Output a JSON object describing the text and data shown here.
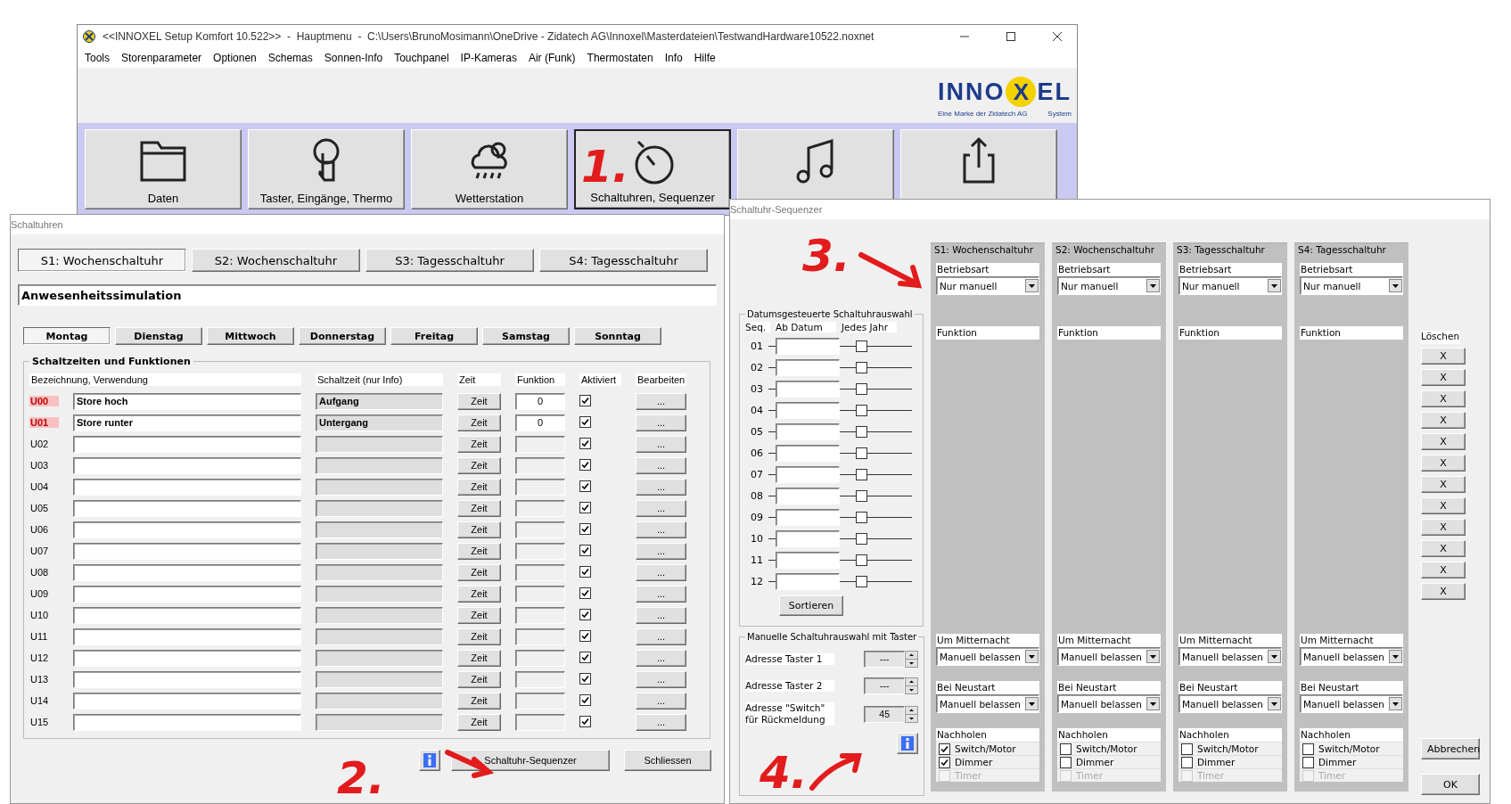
{
  "main_window": {
    "title": "<<INNOXEL Setup Komfort 10.522>>  -  Hauptmenu  -  C:\\Users\\BrunoMosimann\\OneDrive - Zidatech AG\\Innoxel\\Masterdateien\\TestwandHardware10522.noxnet",
    "menu": [
      "Tools",
      "Storenparameter",
      "Optionen",
      "Schemas",
      "Sonnen-Info",
      "Touchpanel",
      "IP-Kameras",
      "Air (Funk)",
      "Thermostaten",
      "Info",
      "Hilfe"
    ],
    "logo": {
      "left": "INNO",
      "mark": "X",
      "right": "EL",
      "tagline": "Eine Marke der Zidatech AG",
      "suffix": "System"
    },
    "toolbar": [
      {
        "label": "Daten",
        "kind": "folder",
        "selected": false
      },
      {
        "label": "Taster, Eingänge, Thermo",
        "kind": "touch",
        "selected": false
      },
      {
        "label": "Wetterstation",
        "kind": "weather",
        "selected": false
      },
      {
        "label": "Schaltuhren, Sequenzer",
        "kind": "timer",
        "selected": true
      },
      {
        "kind": "music",
        "selected": false
      },
      {
        "kind": "share",
        "selected": false
      }
    ]
  },
  "schaltuhren": {
    "title": "Schaltuhren",
    "tabs": [
      {
        "label": "S1: Wochenschaltuhr",
        "selected": true
      },
      {
        "label": "S2: Wochenschaltuhr",
        "selected": false
      },
      {
        "label": "S3: Tagesschaltuhr",
        "selected": false
      },
      {
        "label": "S4: Tagesschaltuhr",
        "selected": false
      }
    ],
    "name": "Anwesenheitssimulation",
    "days": [
      {
        "label": "Montag",
        "selected": true
      },
      {
        "label": "Dienstag",
        "selected": false
      },
      {
        "label": "Mittwoch",
        "selected": false
      },
      {
        "label": "Donnerstag",
        "selected": false
      },
      {
        "label": "Freitag",
        "selected": false
      },
      {
        "label": "Samstag",
        "selected": false
      },
      {
        "label": "Sonntag",
        "selected": false
      }
    ],
    "group_title": "Schaltzeiten und Funktionen",
    "columns": [
      "Bezeichnung, Verwendung",
      "Schaltzeit (nur Info)",
      "Zeit",
      "Funktion",
      "Aktiviert",
      "Bearbeiten"
    ],
    "rows": [
      {
        "id": "U00",
        "highlight": true,
        "name": "Store hoch",
        "time_info": "Aufgang",
        "zeit": "Zeit",
        "function": "0",
        "activated": true,
        "edit": "..."
      },
      {
        "id": "U01",
        "highlight": true,
        "name": "Store runter",
        "time_info": "Untergang",
        "zeit": "Zeit",
        "function": "0",
        "activated": true,
        "edit": "..."
      },
      {
        "id": "U02",
        "highlight": false,
        "zeit": "Zeit",
        "activated": true,
        "edit": "..."
      },
      {
        "id": "U03",
        "highlight": false,
        "zeit": "Zeit",
        "activated": true,
        "edit": "..."
      },
      {
        "id": "U04",
        "highlight": false,
        "zeit": "Zeit",
        "activated": true,
        "edit": "..."
      },
      {
        "id": "U05",
        "highlight": false,
        "zeit": "Zeit",
        "activated": true,
        "edit": "..."
      },
      {
        "id": "U06",
        "highlight": false,
        "zeit": "Zeit",
        "activated": true,
        "edit": "..."
      },
      {
        "id": "U07",
        "highlight": false,
        "zeit": "Zeit",
        "activated": true,
        "edit": "..."
      },
      {
        "id": "U08",
        "highlight": false,
        "zeit": "Zeit",
        "activated": true,
        "edit": "..."
      },
      {
        "id": "U09",
        "highlight": false,
        "zeit": "Zeit",
        "activated": true,
        "edit": "..."
      },
      {
        "id": "U10",
        "highlight": false,
        "zeit": "Zeit",
        "activated": true,
        "edit": "..."
      },
      {
        "id": "U11",
        "highlight": false,
        "zeit": "Zeit",
        "activated": true,
        "edit": "..."
      },
      {
        "id": "U12",
        "highlight": false,
        "zeit": "Zeit",
        "activated": true,
        "edit": "..."
      },
      {
        "id": "U13",
        "highlight": false,
        "zeit": "Zeit",
        "activated": true,
        "edit": "..."
      },
      {
        "id": "U14",
        "highlight": false,
        "zeit": "Zeit",
        "activated": true,
        "edit": "..."
      },
      {
        "id": "U15",
        "highlight": false,
        "zeit": "Zeit",
        "activated": true,
        "edit": "..."
      }
    ],
    "sequencer_button": "Schaltuhr-Sequenzer",
    "close_button": "Schliessen"
  },
  "sequenzer": {
    "title": "Schaltuhr-Sequenzer",
    "date_group": {
      "title": "Datumsgesteuerte Schaltuhrauswahl",
      "headers": [
        "Seq.",
        "Ab Datum",
        "Jedes Jahr"
      ],
      "delete_header": "Löschen",
      "rows": [
        {
          "seq": "01",
          "every_year": false,
          "delete": "X"
        },
        {
          "seq": "02",
          "every_year": false,
          "delete": "X"
        },
        {
          "seq": "03",
          "every_year": false,
          "delete": "X"
        },
        {
          "seq": "04",
          "every_year": false,
          "delete": "X"
        },
        {
          "seq": "05",
          "every_year": false,
          "delete": "X"
        },
        {
          "seq": "06",
          "every_year": false,
          "delete": "X"
        },
        {
          "seq": "07",
          "every_year": false,
          "delete": "X"
        },
        {
          "seq": "08",
          "every_year": false,
          "delete": "X"
        },
        {
          "seq": "09",
          "every_year": false,
          "delete": "X"
        },
        {
          "seq": "10",
          "every_year": false,
          "delete": "X"
        },
        {
          "seq": "11",
          "every_year": false,
          "delete": "X"
        },
        {
          "seq": "12",
          "every_year": false,
          "delete": "X"
        }
      ],
      "sort_button": "Sortieren"
    },
    "manual_group": {
      "title": "Manuelle Schaltuhrauswahl mit Taster",
      "fields": [
        {
          "label": "Adresse Taster 1",
          "value": "---"
        },
        {
          "label": "Adresse Taster 2",
          "value": "---"
        },
        {
          "label": "Adresse \"Switch\" für Rückmeldung",
          "value": "45"
        }
      ]
    },
    "columns": [
      {
        "title": "S1: Wochenschaltuhr",
        "mode_label": "Betriebsart",
        "mode": "Nur manuell",
        "function_label": "Funktion",
        "midnight_label": "Um Mitternacht",
        "midnight": "Manuell belassen",
        "restart_label": "Bei Neustart",
        "restart": "Manuell belassen",
        "catchup_label": "Nachholen",
        "catchup": [
          {
            "label": "Switch/Motor",
            "checked": true,
            "disabled": false
          },
          {
            "label": "Dimmer",
            "checked": true,
            "disabled": false
          },
          {
            "label": "Timer",
            "checked": false,
            "disabled": true
          }
        ]
      },
      {
        "title": "S2: Wochenschaltuhr",
        "mode_label": "Betriebsart",
        "mode": "Nur manuell",
        "function_label": "Funktion",
        "midnight_label": "Um Mitternacht",
        "midnight": "Manuell belassen",
        "restart_label": "Bei Neustart",
        "restart": "Manuell belassen",
        "catchup_label": "Nachholen",
        "catchup": [
          {
            "label": "Switch/Motor",
            "checked": false,
            "disabled": false
          },
          {
            "label": "Dimmer",
            "checked": false,
            "disabled": false
          },
          {
            "label": "Timer",
            "checked": false,
            "disabled": true
          }
        ]
      },
      {
        "title": "S3: Tagesschaltuhr",
        "mode_label": "Betriebsart",
        "mode": "Nur manuell",
        "function_label": "Funktion",
        "midnight_label": "Um Mitternacht",
        "midnight": "Manuell belassen",
        "restart_label": "Bei Neustart",
        "restart": "Manuell belassen",
        "catchup_label": "Nachholen",
        "catchup": [
          {
            "label": "Switch/Motor",
            "checked": false,
            "disabled": false
          },
          {
            "label": "Dimmer",
            "checked": false,
            "disabled": false
          },
          {
            "label": "Timer",
            "checked": false,
            "disabled": true
          }
        ]
      },
      {
        "title": "S4: Tagesschaltuhr",
        "mode_label": "Betriebsart",
        "mode": "Nur manuell",
        "function_label": "Funktion",
        "midnight_label": "Um Mitternacht",
        "midnight": "Manuell belassen",
        "restart_label": "Bei Neustart",
        "restart": "Manuell belassen",
        "catchup_label": "Nachholen",
        "catchup": [
          {
            "label": "Switch/Motor",
            "checked": false,
            "disabled": false
          },
          {
            "label": "Dimmer",
            "checked": false,
            "disabled": false
          },
          {
            "label": "Timer",
            "checked": false,
            "disabled": true
          }
        ]
      }
    ],
    "cancel_button": "Abbrechen",
    "ok_button": "OK"
  },
  "annotations": [
    "1.",
    "2.",
    "3.",
    "4."
  ]
}
